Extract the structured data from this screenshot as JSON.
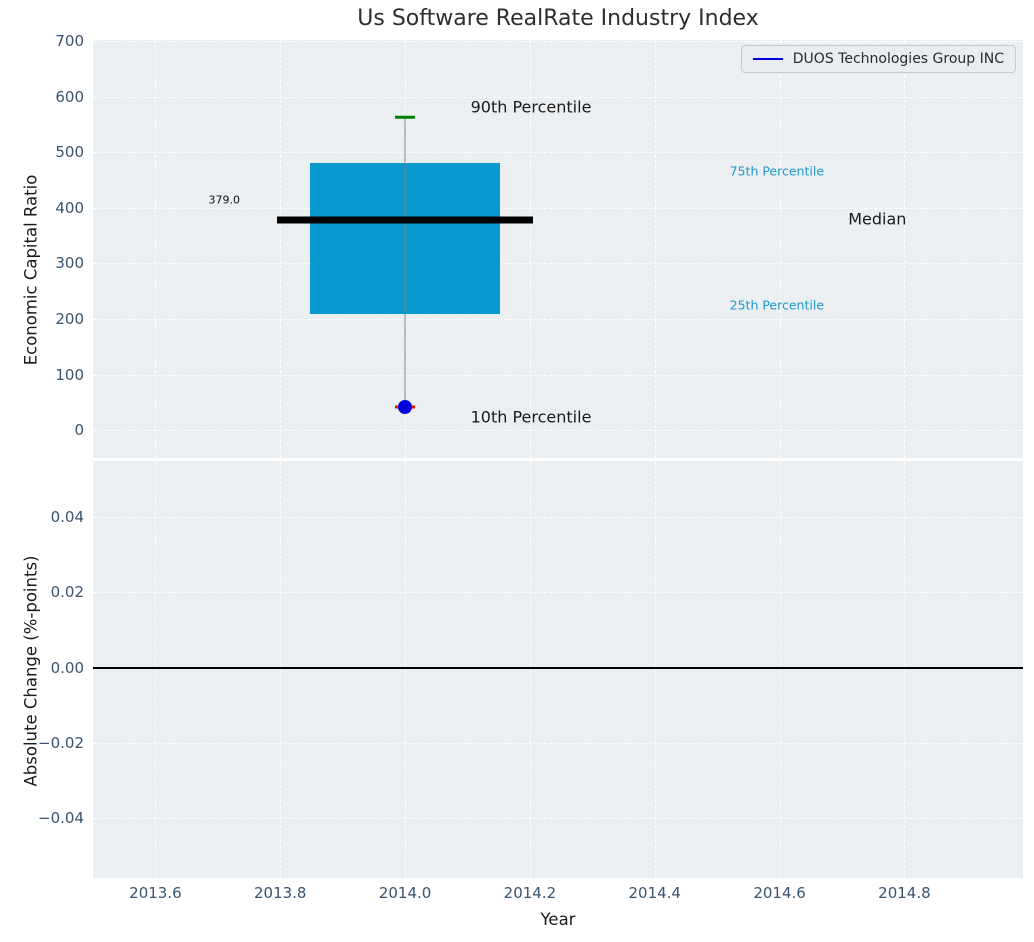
{
  "chart_data": {
    "type": "boxplot",
    "title": "Us Software RealRate Industry Index",
    "xlabel": "Year",
    "plot_bg_color": "#eceff2",
    "grid_color": "#ffffff",
    "x_range": [
      2013.5,
      2014.99
    ],
    "x_ticks": [
      {
        "v": 2013.6,
        "label": "2013.6"
      },
      {
        "v": 2013.8,
        "label": "2013.8"
      },
      {
        "v": 2014.0,
        "label": "2014.0"
      },
      {
        "v": 2014.2,
        "label": "2014.2"
      },
      {
        "v": 2014.4,
        "label": "2014.4"
      },
      {
        "v": 2014.6,
        "label": "2014.6"
      },
      {
        "v": 2014.8,
        "label": "2014.8"
      }
    ],
    "top_panel": {
      "ylabel": "Economic Capital Ratio",
      "y_range": [
        -50,
        702
      ],
      "y_ticks": [
        {
          "v": 0,
          "label": "0"
        },
        {
          "v": 100,
          "label": "100"
        },
        {
          "v": 200,
          "label": "200"
        },
        {
          "v": 300,
          "label": "300"
        },
        {
          "v": 400,
          "label": "400"
        },
        {
          "v": 500,
          "label": "500"
        },
        {
          "v": 600,
          "label": "600"
        },
        {
          "v": 700,
          "label": "700"
        }
      ],
      "legend": {
        "label": "DUOS Technologies Group INC",
        "line_color": "#0000dd"
      },
      "box": {
        "x": 2014.0,
        "p10": 41,
        "p25": 209,
        "median": 379.0,
        "p75": 480,
        "p90": 563,
        "box_half_width": 0.152,
        "median_half_width": 0.205,
        "cap_half_width": 0.016,
        "box_color": "#0899cf",
        "median_color": "#000000",
        "whisker_color": "#808080",
        "p90_cap_color": "#008000",
        "p10_cap_color": "#ee1100",
        "p10_dot_color": "#0000dd"
      },
      "annotations": [
        {
          "text": "90th Percentile",
          "x": 2014.105,
          "y": 582,
          "color": "#1a1a1a",
          "size": 16
        },
        {
          "text": "10th Percentile",
          "x": 2014.105,
          "y": 23,
          "color": "#1a1a1a",
          "size": 16
        },
        {
          "text": "75th Percentile",
          "x": 2014.52,
          "y": 467,
          "color": "#2097cb",
          "size": 12.5
        },
        {
          "text": "25th Percentile",
          "x": 2014.52,
          "y": 225,
          "color": "#2097cb",
          "size": 12.5
        },
        {
          "text": "Median",
          "x": 2014.71,
          "y": 380,
          "color": "#1a1a1a",
          "size": 16
        },
        {
          "text": "379.0",
          "x": 2013.685,
          "y": 414,
          "color": "#111111",
          "size": 11
        }
      ]
    },
    "bottom_panel": {
      "ylabel": "Absolute Change (%-points)",
      "y_range": [
        -0.056,
        0.055
      ],
      "y_ticks": [
        {
          "v": 0.04,
          "label": "0.04"
        },
        {
          "v": 0.02,
          "label": "0.02"
        },
        {
          "v": 0.0,
          "label": "0.00"
        },
        {
          "v": -0.02,
          "label": "−0.02"
        },
        {
          "v": -0.04,
          "label": "−0.04"
        }
      ],
      "zero_line": {
        "y": 0,
        "color": "#000000"
      }
    }
  }
}
